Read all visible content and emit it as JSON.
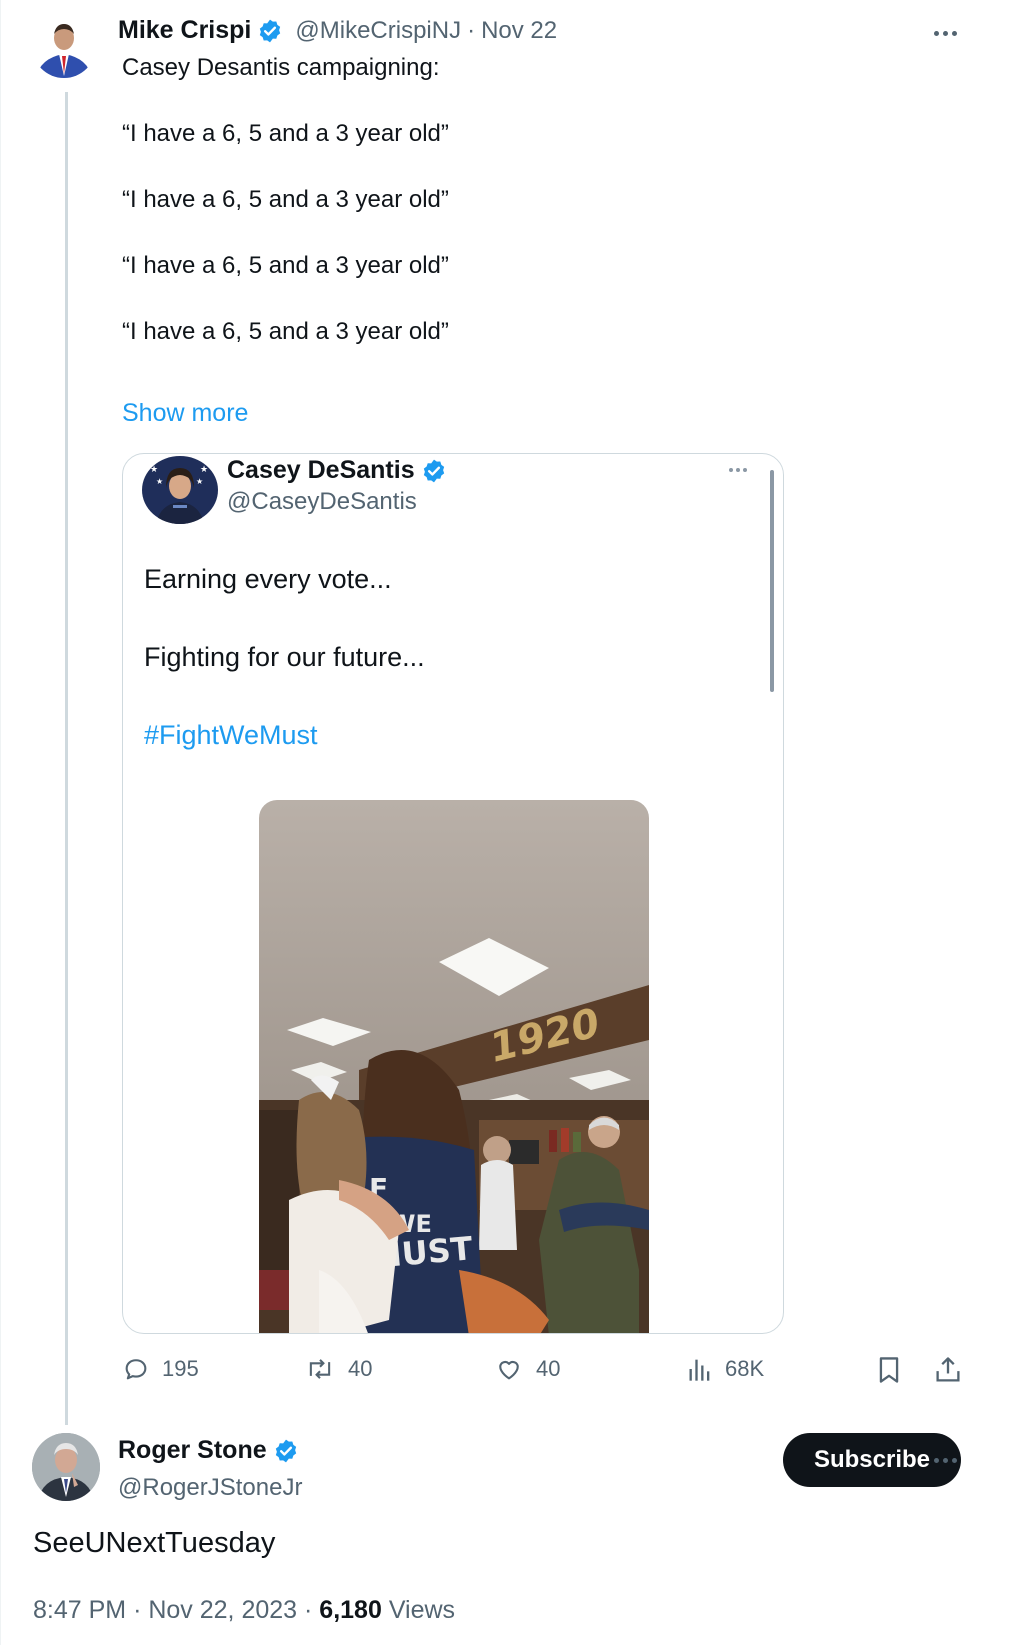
{
  "main_tweet": {
    "author_name": "Mike Crispi",
    "handle": "@MikeCrispiNJ",
    "date": "Nov 22",
    "separator": "·",
    "lines": [
      "Casey Desantis campaigning:",
      "“I have a 6, 5 and a 3 year old”",
      "“I have a 6, 5 and a 3 year old”",
      "“I have a 6, 5 and a 3 year old”",
      "“I have a 6, 5 and a 3 year old”"
    ],
    "show_more": "Show more"
  },
  "quoted_tweet": {
    "author_name": "Casey DeSantis",
    "handle": "@CaseyDeSantis",
    "lines": [
      "Earning every vote...",
      "Fighting for our future..."
    ],
    "hashtag": "#FightWeMust",
    "video_sign_text": "1920",
    "shirt_text_top": "F",
    "shirt_text_mid": "WE",
    "shirt_text_bottom": "MUST"
  },
  "actions": {
    "replies": "195",
    "reposts": "40",
    "likes": "40",
    "views": "68K"
  },
  "reply": {
    "author_name": "Roger Stone",
    "handle": "@RogerJStoneJr",
    "subscribe_label": "Subscribe",
    "text": "SeeUNextTuesday",
    "time": "8:47 PM",
    "date": "Nov 22, 2023",
    "separator": "·",
    "view_count": "6,180",
    "views_label": "Views"
  },
  "colors": {
    "accent": "#1d9bf0",
    "text": "#0f1419",
    "muted": "#536471",
    "border": "#cfd9de",
    "button": "#0f1419"
  },
  "icons": [
    "verified-badge-icon",
    "more-icon",
    "reply-icon",
    "repost-icon",
    "like-icon",
    "views-icon",
    "bookmark-icon",
    "share-icon"
  ]
}
